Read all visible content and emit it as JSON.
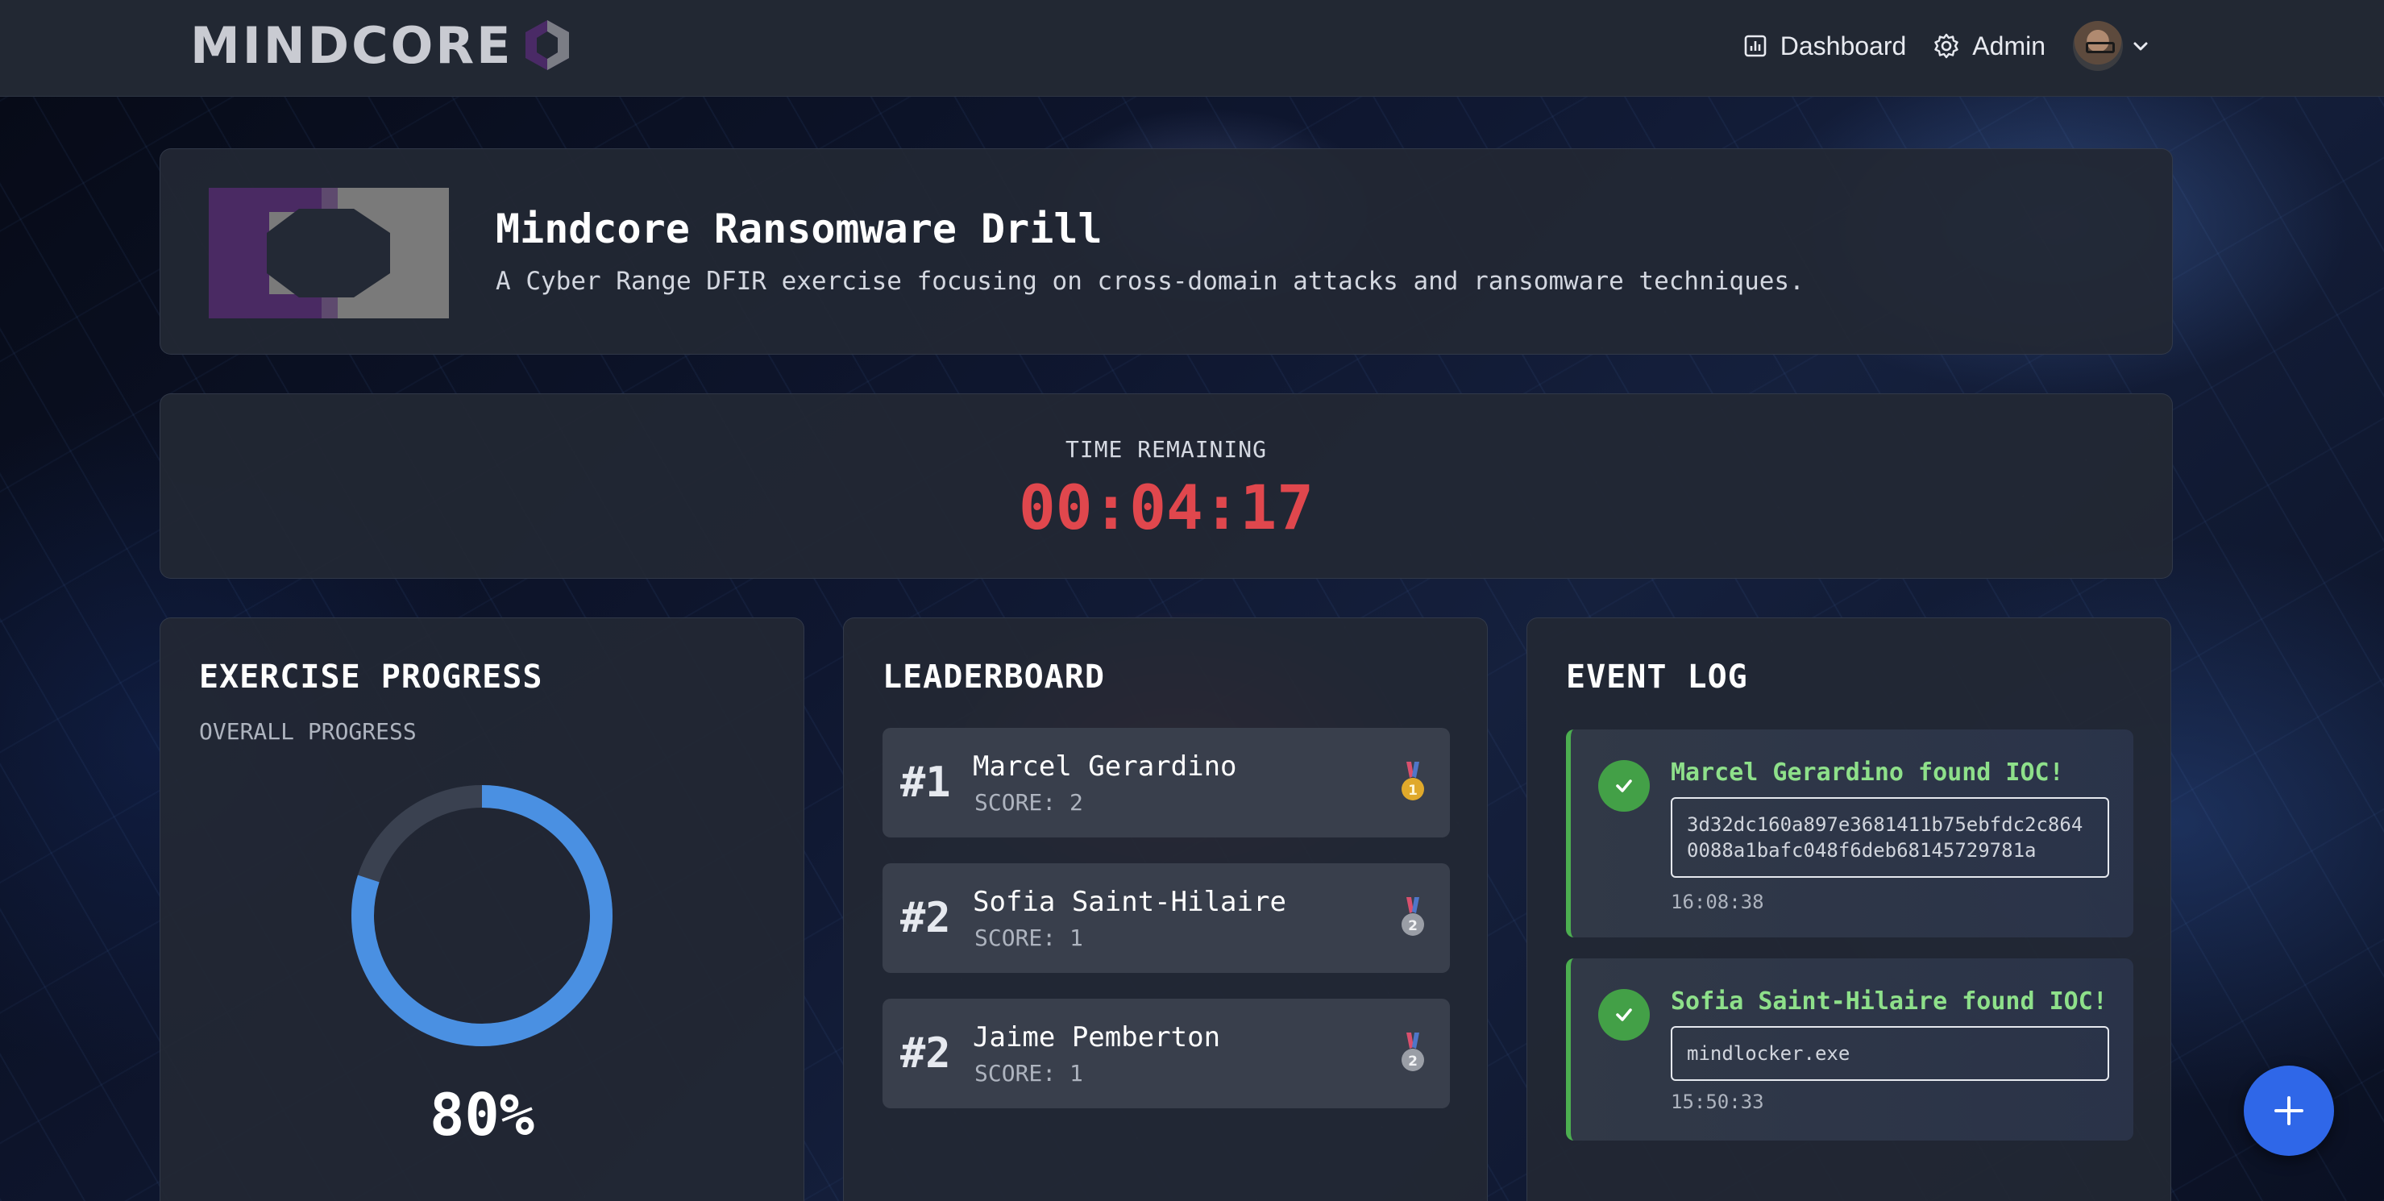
{
  "header": {
    "brand": "MINDCORE",
    "nav": [
      {
        "label": "Dashboard",
        "icon": "bar-chart-icon"
      },
      {
        "label": "Admin",
        "icon": "gear-icon"
      }
    ],
    "avatar_icon": "chevron-down-icon"
  },
  "exercise": {
    "title": "Mindcore Ransomware Drill",
    "description": "A Cyber Range DFIR exercise focusing on cross-domain attacks and ransomware techniques."
  },
  "timer": {
    "label": "TIME REMAINING",
    "value": "00:04:17",
    "color": "#e0474d"
  },
  "progress": {
    "title": "EXERCISE PROGRESS",
    "subtitle": "OVERALL PROGRESS",
    "percent_label": "80%",
    "fraction": 0.8,
    "accent": "#4a90e2"
  },
  "leaderboard": {
    "title": "LEADERBOARD",
    "entries": [
      {
        "rank": "#1",
        "name": "Marcel Gerardino",
        "score": "SCORE: 2",
        "medal": "gold",
        "medal_number": "1"
      },
      {
        "rank": "#2",
        "name": "Sofia Saint-Hilaire",
        "score": "SCORE: 1",
        "medal": "silver",
        "medal_number": "2"
      },
      {
        "rank": "#2",
        "name": "Jaime Pemberton",
        "score": "SCORE: 1",
        "medal": "silver",
        "medal_number": "2"
      }
    ]
  },
  "event_log": {
    "title": "EVENT LOG",
    "events": [
      {
        "title": "Marcel Gerardino found IOC!",
        "ioc": "3d32dc160a897e3681411b75ebfdc2c8640088a1bafc048f6deb68145729781a",
        "time": "16:08:38"
      },
      {
        "title": "Sofia Saint-Hilaire found IOC!",
        "ioc": "mindlocker.exe",
        "time": "15:50:33"
      }
    ]
  },
  "fab": {
    "icon": "plus-icon"
  }
}
